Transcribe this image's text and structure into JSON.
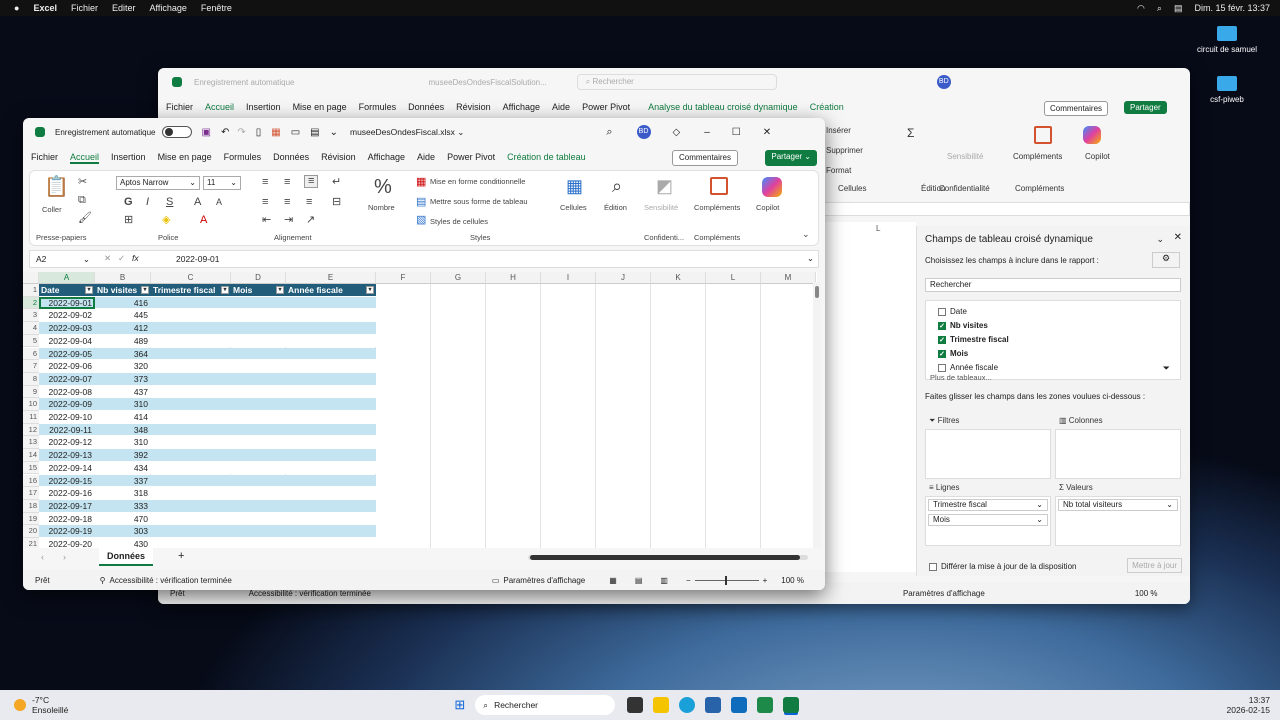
{
  "menubar": {
    "app": "Excel",
    "items": [
      "Fichier",
      "Editer",
      "Affichage",
      "Fenêtre"
    ],
    "clock": "Dim. 15 févr. 13:37"
  },
  "desktop": {
    "icons": [
      "circuit de samuel",
      "csf-piweb"
    ]
  },
  "back_window": {
    "autosave": "Enregistrement automatique",
    "filename": "museeDesOndesFiscalSolution...",
    "search": "Rechercher",
    "avatar": "BD",
    "tabs": [
      "Fichier",
      "Accueil",
      "Insertion",
      "Mise en page",
      "Formules",
      "Données",
      "Révision",
      "Affichage",
      "Aide",
      "Power Pivot"
    ],
    "context_tabs": [
      "Analyse du tableau croisé dynamique",
      "Création"
    ],
    "comments": "Commentaires",
    "share": "Partager",
    "ribbon": {
      "inserer": "Insérer",
      "supprimer": "Supprimer",
      "format": "Format",
      "cellules": "Cellules",
      "edition": "Édition",
      "sensibilite": "Sensibilité",
      "confidentialite": "Confidentialité",
      "complements": "Compléments",
      "complements_group": "Compléments",
      "copilot": "Copilot"
    },
    "col_l": "L",
    "pivot": {
      "title": "Champs de tableau croisé dynamique",
      "choose": "Choisissez les champs à inclure dans le rapport :",
      "search": "Rechercher",
      "fields": [
        {
          "name": "Date",
          "checked": false
        },
        {
          "name": "Nb visites",
          "checked": true
        },
        {
          "name": "Trimestre fiscal",
          "checked": true
        },
        {
          "name": "Mois",
          "checked": true
        },
        {
          "name": "Année fiscale",
          "checked": false
        }
      ],
      "more": "Plus de tableaux...",
      "drag": "Faites glisser les champs dans les zones voulues ci-dessous :",
      "filtres": "Filtres",
      "colonnes": "Colonnes",
      "lignes": "Lignes",
      "valeurs": "Valeurs",
      "rows": [
        "Trimestre fiscal",
        "Mois"
      ],
      "values": [
        "Nb total visiteurs"
      ],
      "defer": "Différer la mise à jour de la disposition",
      "update": "Mettre à jour"
    },
    "status": {
      "ready": "Prêt",
      "access": "Accessibilité : vérification terminée",
      "display": "Paramètres d'affichage",
      "zoom": "100 %"
    }
  },
  "front_window": {
    "autosave": "Enregistrement automatique",
    "filename": "museeDesOndesFiscal.xlsx",
    "avatar": "BD",
    "tabs": [
      "Fichier",
      "Accueil",
      "Insertion",
      "Mise en page",
      "Formules",
      "Données",
      "Révision",
      "Affichage",
      "Aide",
      "Power Pivot"
    ],
    "active_tab": "Accueil",
    "context_tab": "Création de tableau",
    "comments": "Commentaires",
    "share": "Partager",
    "ribbon": {
      "coller": "Coller",
      "presse_papiers": "Presse-papiers",
      "font": "Aptos Narrow",
      "size": "11",
      "police": "Police",
      "alignment": "Alignement",
      "nombre": "Nombre",
      "mfc": "Mise en forme conditionnelle",
      "mst": "Mettre sous forme de tableau",
      "styles_cell": "Styles de cellules",
      "styles": "Styles",
      "cellules": "Cellules",
      "edition": "Édition",
      "sensibilite": "Sensibilité",
      "confidentialite": "Confidenti...",
      "complements": "Compléments",
      "complements_group": "Compléments",
      "copilot": "Copilot"
    },
    "namebox": "A2",
    "formula": "2022-09-01",
    "columns": [
      "A",
      "B",
      "C",
      "D",
      "E",
      "F",
      "G",
      "H",
      "I",
      "J",
      "K",
      "L",
      "M"
    ],
    "headers": [
      "Date",
      "Nb visites",
      "Trimestre fiscal",
      "Mois",
      "Année fiscale"
    ],
    "rows": [
      [
        "2022-09-01",
        "416"
      ],
      [
        "2022-09-02",
        "445"
      ],
      [
        "2022-09-03",
        "412"
      ],
      [
        "2022-09-04",
        "489"
      ],
      [
        "2022-09-05",
        "364"
      ],
      [
        "2022-09-06",
        "320"
      ],
      [
        "2022-09-07",
        "373"
      ],
      [
        "2022-09-08",
        "437"
      ],
      [
        "2022-09-09",
        "310"
      ],
      [
        "2022-09-10",
        "414"
      ],
      [
        "2022-09-11",
        "348"
      ],
      [
        "2022-09-12",
        "310"
      ],
      [
        "2022-09-13",
        "392"
      ],
      [
        "2022-09-14",
        "434"
      ],
      [
        "2022-09-15",
        "337"
      ],
      [
        "2022-09-16",
        "318"
      ],
      [
        "2022-09-17",
        "333"
      ],
      [
        "2022-09-18",
        "470"
      ],
      [
        "2022-09-19",
        "303"
      ],
      [
        "2022-09-20",
        "430"
      ]
    ],
    "sheet": "Données",
    "status": {
      "ready": "Prêt",
      "access": "Accessibilité : vérification terminée",
      "display": "Paramètres d'affichage",
      "zoom": "100 %"
    }
  },
  "taskbar": {
    "weather_temp": "-7°C",
    "weather_desc": "Ensoleillé",
    "search": "Rechercher",
    "time": "13:37",
    "date": "2026-02-15"
  }
}
